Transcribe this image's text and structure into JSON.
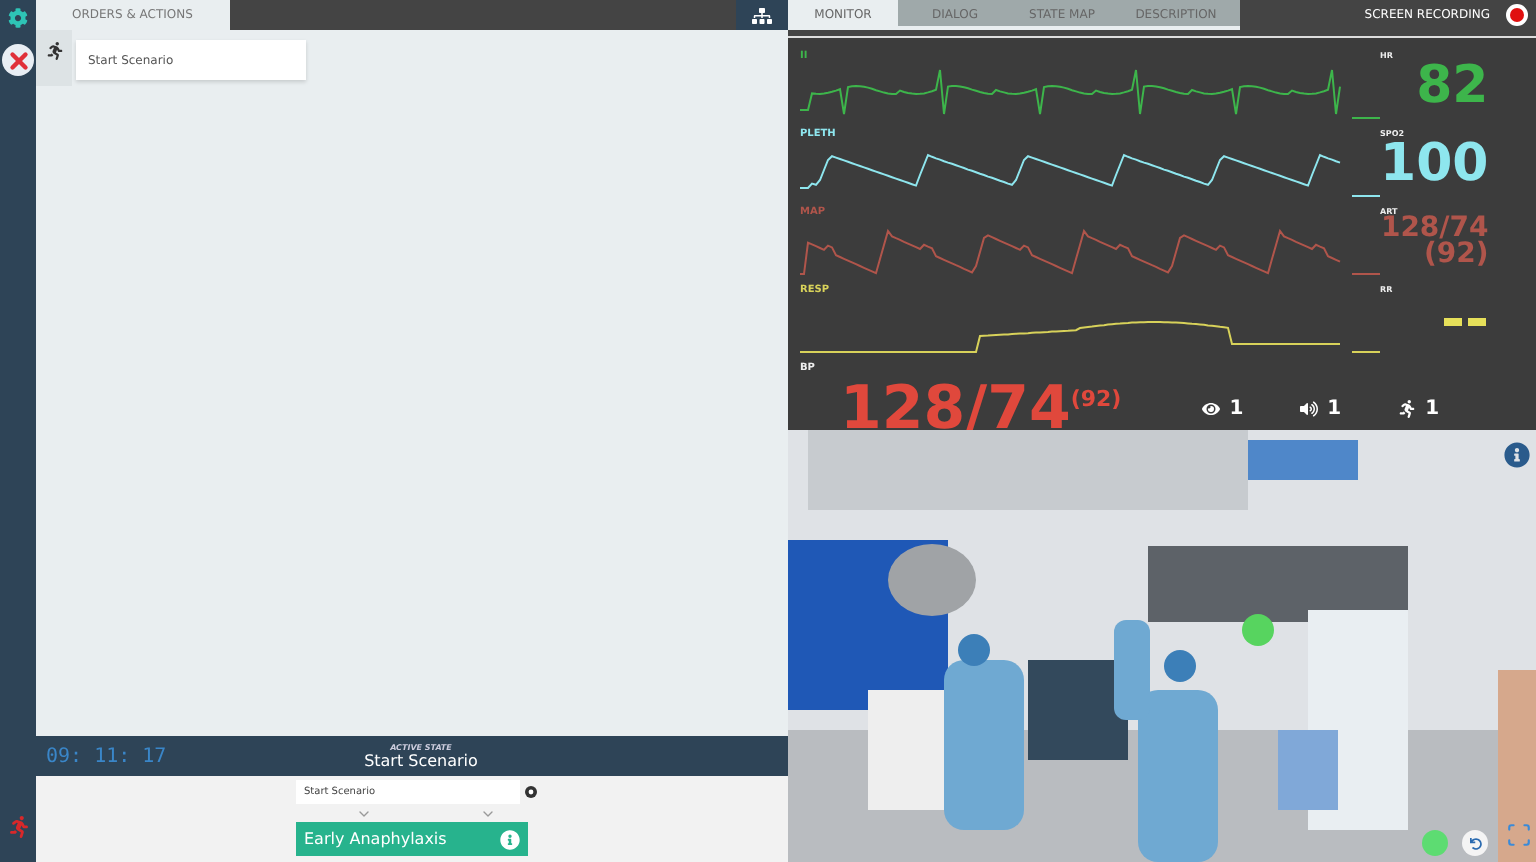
{
  "left_panel": {
    "tabs": [
      {
        "label": "ORDERS & ACTIONS",
        "selected": true
      }
    ],
    "order_field": {
      "placeholder": "Start Scenario"
    }
  },
  "state_bar": {
    "clock": "09: 11: 17",
    "caption": "ACTIVE STATE",
    "state": "Start Scenario"
  },
  "transition": {
    "from": "Start Scenario",
    "to": "Early Anaphylaxis"
  },
  "right_tabs": [
    {
      "label": "MONITOR",
      "selected": true
    },
    {
      "label": "DIALOG",
      "selected": false
    },
    {
      "label": "STATE MAP",
      "selected": false
    },
    {
      "label": "DESCRIPTION",
      "selected": false
    }
  ],
  "recording": {
    "label": "SCREEN RECORDING",
    "on": true
  },
  "monitor": {
    "waves": [
      {
        "label": "II",
        "kind": "ecg",
        "color": "#3db54b"
      },
      {
        "label": "PLETH",
        "kind": "pleth",
        "color": "#8ee6ee"
      },
      {
        "label": "MAP",
        "kind": "art",
        "color": "#b0554b"
      },
      {
        "label": "RESP",
        "kind": "resp",
        "color": "#d8d25a"
      }
    ],
    "vitals": [
      {
        "label": "HR",
        "value": "82",
        "kind": "number",
        "color": "#3db54b"
      },
      {
        "label": "SPO2",
        "value": "100",
        "kind": "number",
        "color": "#8ee6ee"
      },
      {
        "label": "ART",
        "value": "128/74",
        "sub": "(92)",
        "kind": "pressure",
        "color": "#b0554b"
      },
      {
        "label": "RR",
        "kind": "dashes",
        "color": "#e6e05a"
      }
    ],
    "bp_label": "BP",
    "bp": "128/74$^{(92)}$",
    "counters": [
      {
        "kind": "eye",
        "value": "1"
      },
      {
        "kind": "sound",
        "value": "1"
      },
      {
        "kind": "runner",
        "value": "1"
      }
    ]
  },
  "scene": {
    "kind": "picture",
    "status_on": true
  }
}
